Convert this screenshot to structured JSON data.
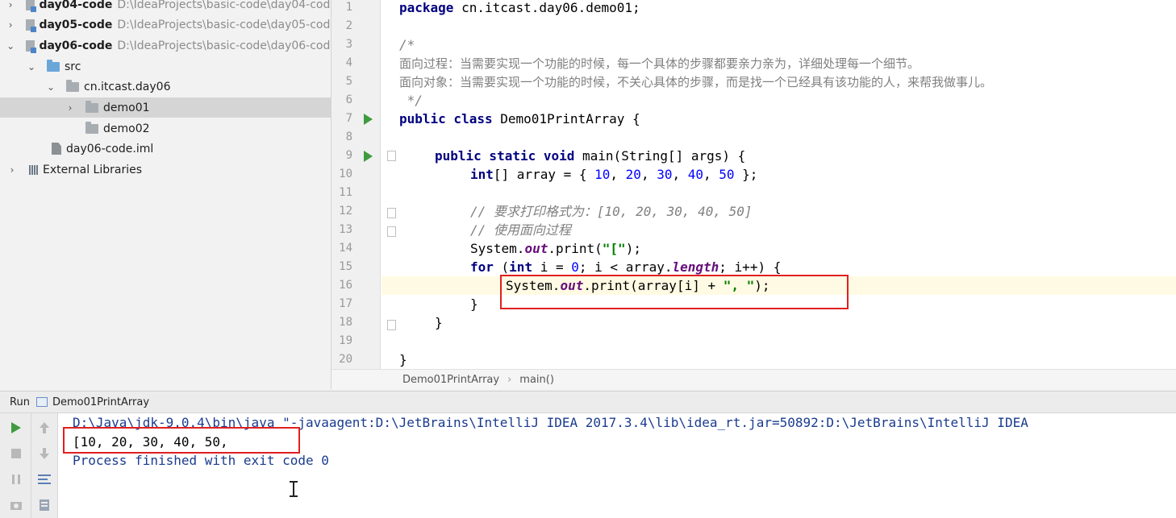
{
  "project_tree": {
    "items": [
      {
        "chevron": "›",
        "name": "day04-code",
        "path": "D:\\IdeaProjects\\basic-code\\day04-code",
        "kind": "module"
      },
      {
        "chevron": "›",
        "name": "day05-code",
        "path": "D:\\IdeaProjects\\basic-code\\day05-code",
        "kind": "module"
      },
      {
        "chevron": "⌄",
        "name": "day06-code",
        "path": "D:\\IdeaProjects\\basic-code\\day06-code",
        "kind": "module"
      },
      {
        "chevron": "⌄",
        "name": "src",
        "path": "",
        "kind": "src"
      },
      {
        "chevron": "⌄",
        "name": "cn.itcast.day06",
        "path": "",
        "kind": "package"
      },
      {
        "chevron": "›",
        "name": "demo01",
        "path": "",
        "kind": "package"
      },
      {
        "chevron": "",
        "name": "demo02",
        "path": "",
        "kind": "package"
      },
      {
        "chevron": "",
        "name": "day06-code.iml",
        "path": "",
        "kind": "file"
      },
      {
        "chevron": "›",
        "name": "External Libraries",
        "path": "",
        "kind": "library"
      }
    ]
  },
  "editor": {
    "line_numbers": [
      "1",
      "2",
      "3",
      "4",
      "5",
      "6",
      "7",
      "8",
      "9",
      "10",
      "11",
      "12",
      "13",
      "14",
      "15",
      "16",
      "17",
      "18",
      "19",
      "20"
    ],
    "code": {
      "l1_kw": "package",
      "l1_rest": " cn.itcast.day06.demo01;",
      "l3": "/*",
      "l4": "面向过程：当需要实现一个功能的时候，每一个具体的步骤都要亲力亲为，详细处理每一个细节。",
      "l5": "面向对象：当需要实现一个功能的时候，不关心具体的步骤，而是找一个已经具有该功能的人，来帮我做事儿。",
      "l6": " */",
      "l7_kw": "public class",
      "l7_rest": " Demo01PrintArray {",
      "l9_kw": "public static void",
      "l9_rest": " main(String[] args) {",
      "l10_kw": "int",
      "l10_a": "[] array = { ",
      "l10_n1": "10",
      "l10_n2": "20",
      "l10_n3": "30",
      "l10_n4": "40",
      "l10_n5": "50",
      "l10_end": " };",
      "l12": "// 要求打印格式为：[10, 20, 30, 40, 50]",
      "l13": "// 使用面向过程",
      "l14_a": "System.",
      "l14_f": "out",
      "l14_b": ".print(",
      "l14_s": "\"[\"",
      "l14_c": ");",
      "l15_kw1": "for",
      "l15_a": " (",
      "l15_kw2": "int",
      "l15_b": " i = ",
      "l15_n": "0",
      "l15_c": "; i < array.",
      "l15_f": "length",
      "l15_d": "; i++) {",
      "l16_a": "System.",
      "l16_f": "out",
      "l16_b": ".print(array[i] + ",
      "l16_s": "\", \"",
      "l16_c": ");",
      "l17": "}",
      "l18": "}",
      "l20": "}"
    }
  },
  "breadcrumb": {
    "class_name": "Demo01PrintArray",
    "separator": "›",
    "method": "main()"
  },
  "run_panel": {
    "label": "Run",
    "config_name": "Demo01PrintArray",
    "console_lines": [
      "D:\\Java\\jdk-9.0.4\\bin\\java \"-javaagent:D:\\JetBrains\\IntelliJ IDEA 2017.3.4\\lib\\idea_rt.jar=50892:D:\\JetBrains\\IntelliJ IDEA",
      "[10, 20, 30, 40, 50, ",
      "Process finished with exit code 0"
    ]
  }
}
